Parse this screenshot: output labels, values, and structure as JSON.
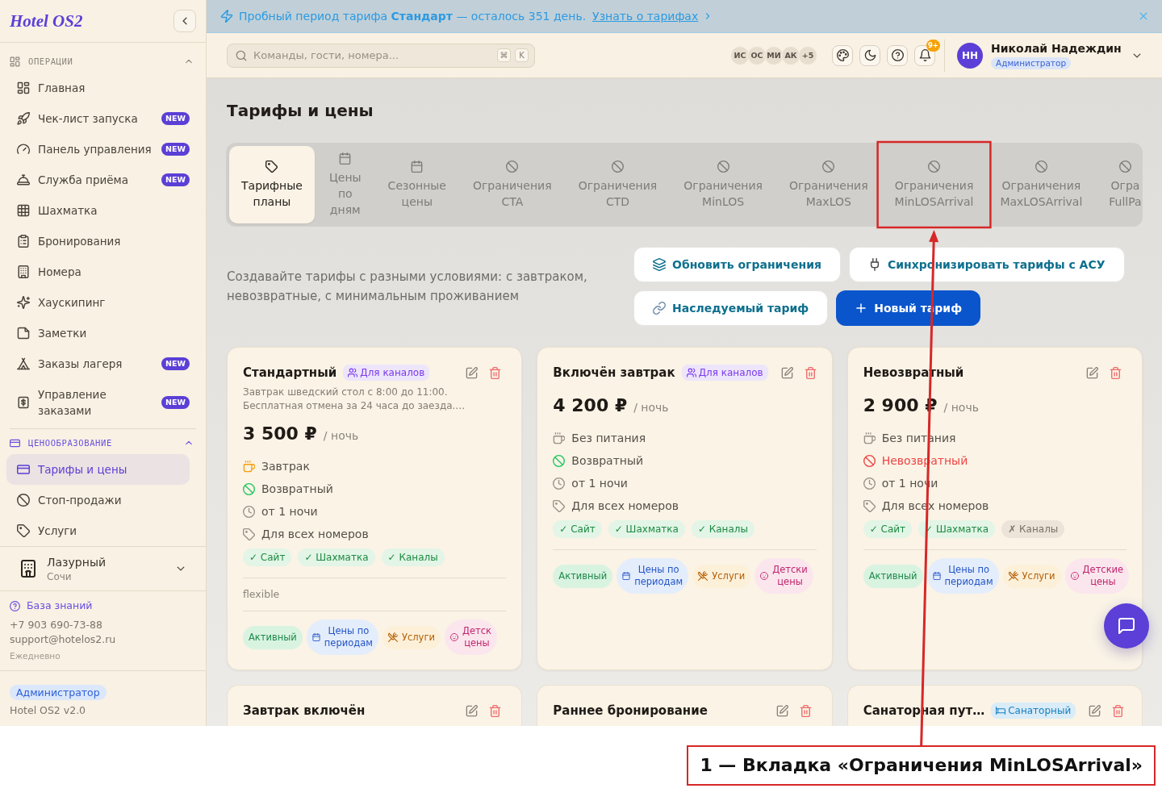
{
  "sidebar": {
    "logo": "Hotel OS2",
    "sections": [
      {
        "title": "ОПЕРАЦИИ",
        "expanded": true,
        "items": [
          {
            "label": "Главная",
            "selected": false
          },
          {
            "label": "Чек-лист запуска",
            "badge": "NEW",
            "selected": false
          },
          {
            "label": "Панель управления",
            "badge": "NEW",
            "selected": false
          },
          {
            "label": "Служба приёма",
            "badge": "NEW",
            "selected": false
          },
          {
            "label": "Шахматка",
            "selected": false
          },
          {
            "label": "Бронирования",
            "selected": false
          },
          {
            "label": "Номера",
            "selected": false
          },
          {
            "label": "Хаускипинг",
            "selected": false
          },
          {
            "label": "Заметки",
            "selected": false
          },
          {
            "label": "Заказы лагеря",
            "badge": "NEW",
            "selected": false
          },
          {
            "label": "Управление\nзаказами",
            "badge": "NEW",
            "selected": false
          }
        ]
      },
      {
        "title": "ЦЕНООБРАЗОВАНИЕ",
        "expanded": true,
        "items": [
          {
            "label": "Тарифы и цены",
            "selected": true
          },
          {
            "label": "Стоп-продажи",
            "selected": false
          },
          {
            "label": "Услуги",
            "selected": false
          }
        ]
      }
    ],
    "hotel": {
      "name": "Лазурный",
      "city": "Сочи"
    },
    "support": {
      "link": "База знаний",
      "phone": "+7 903 690-73-88",
      "email": "support@hotelos2.ru",
      "hours": "Ежедневно"
    },
    "footer": {
      "role": "Администратор",
      "version": "Hotel OS2 v2.0"
    }
  },
  "banner": {
    "message": "Пробный период тарифа **Стандарт** — осталось 351 день.",
    "link": "Узнать о тарифах"
  },
  "header": {
    "search": {
      "placeholder": "Команды, гости, номера...",
      "keys": [
        "⌘",
        "K"
      ]
    },
    "avatars": [
      "ИС",
      "ОС",
      "МИ",
      "АК"
    ],
    "more": "+5",
    "notifications": "9+",
    "user": {
      "initials": "НН",
      "name": "Николай Надеждин",
      "role": "Администратор"
    }
  },
  "page": {
    "title": "Тарифы и цены",
    "tabs": [
      {
        "label": "Тарифные планы",
        "selected": true,
        "highlighted": false
      },
      {
        "label": "Цены по дням",
        "selected": false,
        "highlighted": false
      },
      {
        "label": "Сезонные цены",
        "selected": false,
        "highlighted": false
      },
      {
        "label": "Ограничения CTA",
        "selected": false,
        "highlighted": false
      },
      {
        "label": "Ограничения CTD",
        "selected": false,
        "highlighted": false
      },
      {
        "label": "Ограничения MinLOS",
        "selected": false,
        "highlighted": false
      },
      {
        "label": "Ограничения MaxLOS",
        "selected": false,
        "highlighted": false
      },
      {
        "label": "Ограничения MinLOSArrival",
        "selected": false,
        "highlighted": true
      },
      {
        "label": "Ограничения MaxLOSArrival",
        "selected": false,
        "highlighted": false
      },
      {
        "label": "Огра FullPa",
        "selected": false,
        "highlighted": false
      }
    ],
    "description": "Создавайте тарифы с разными условиями: с завтраком, невозвратные, с минимальным проживанием",
    "actions": [
      {
        "label": "Обновить ограничения",
        "kind": "secondary"
      },
      {
        "label": "Синхронизировать тарифы с АСУ",
        "kind": "secondary"
      },
      {
        "label": "Наследуемый тариф",
        "kind": "secondary"
      },
      {
        "label": "Новый тариф",
        "kind": "primary"
      }
    ],
    "cards": [
      {
        "title": "Стандартный",
        "badge": {
          "label": "Для каналов",
          "kind": "channels"
        },
        "description": "Завтрак шведский стол с 8:00 до 11:00.\nБесплатная отмена за 24 часа до заезда.…",
        "price": "3 500 ₽",
        "unit": "/ ночь",
        "features": [
          {
            "kind": "breakfast",
            "label": "Завтрак"
          },
          {
            "kind": "refundable",
            "label": "Возвратный"
          },
          {
            "kind": "min-stay",
            "label": "от 1 ночи"
          },
          {
            "kind": "rooms",
            "label": "Для всех номеров"
          }
        ],
        "channels": [
          {
            "label": "✓ Сайт",
            "enabled": true
          },
          {
            "label": "✓ Шахматка",
            "enabled": true
          },
          {
            "label": "✓ Каналы",
            "enabled": true
          }
        ],
        "note": "flexible",
        "tags": [
          {
            "label": "Активный",
            "kind": "status"
          },
          {
            "label": "Цены по\nпериодам",
            "kind": "periods"
          },
          {
            "label": "Услуги",
            "kind": "services"
          },
          {
            "label": "Детск\nцены",
            "kind": "children"
          }
        ]
      },
      {
        "title": "Включён завтрак",
        "badge": {
          "label": "Для каналов",
          "kind": "channels"
        },
        "price": "4 200 ₽",
        "unit": "/ ночь",
        "features": [
          {
            "kind": "no-meals",
            "label": "Без питания"
          },
          {
            "kind": "refundable",
            "label": "Возвратный"
          },
          {
            "kind": "min-stay",
            "label": "от 1 ночи"
          },
          {
            "kind": "rooms",
            "label": "Для всех номеров"
          }
        ],
        "channels": [
          {
            "label": "✓ Сайт",
            "enabled": true
          },
          {
            "label": "✓ Шахматка",
            "enabled": true
          },
          {
            "label": "✓ Каналы",
            "enabled": true
          }
        ],
        "tags": [
          {
            "label": "Активный",
            "kind": "status"
          },
          {
            "label": "Цены по\nпериодам",
            "kind": "periods"
          },
          {
            "label": "Услуги",
            "kind": "services"
          },
          {
            "label": "Детски\nцены",
            "kind": "children"
          }
        ]
      },
      {
        "title": "Невозвратный",
        "price": "2 900 ₽",
        "unit": "/ ночь",
        "features": [
          {
            "kind": "no-meals",
            "label": "Без питания"
          },
          {
            "kind": "non-refundable",
            "label": "Невозвратный"
          },
          {
            "kind": "min-stay",
            "label": "от 1 ночи"
          },
          {
            "kind": "rooms",
            "label": "Для всех номеров"
          }
        ],
        "channels": [
          {
            "label": "✓ Сайт",
            "enabled": true
          },
          {
            "label": "✓ Шахматка",
            "enabled": true
          },
          {
            "label": "✗ Каналы",
            "enabled": false
          }
        ],
        "tags": [
          {
            "label": "Активный",
            "kind": "status"
          },
          {
            "label": "Цены по\nпериодам",
            "kind": "periods"
          },
          {
            "label": "Услуги",
            "kind": "services"
          },
          {
            "label": "Детские\nцены",
            "kind": "children"
          }
        ]
      },
      {
        "title": "Завтрак включён"
      },
      {
        "title": "Раннее бронирование"
      },
      {
        "title": "Санаторная пут…",
        "badge": {
          "label": "Санаторный",
          "kind": "sanatorium"
        }
      }
    ]
  },
  "annotation": {
    "label": "1 — Вкладка «Ограничения MinLOSArrival»"
  }
}
